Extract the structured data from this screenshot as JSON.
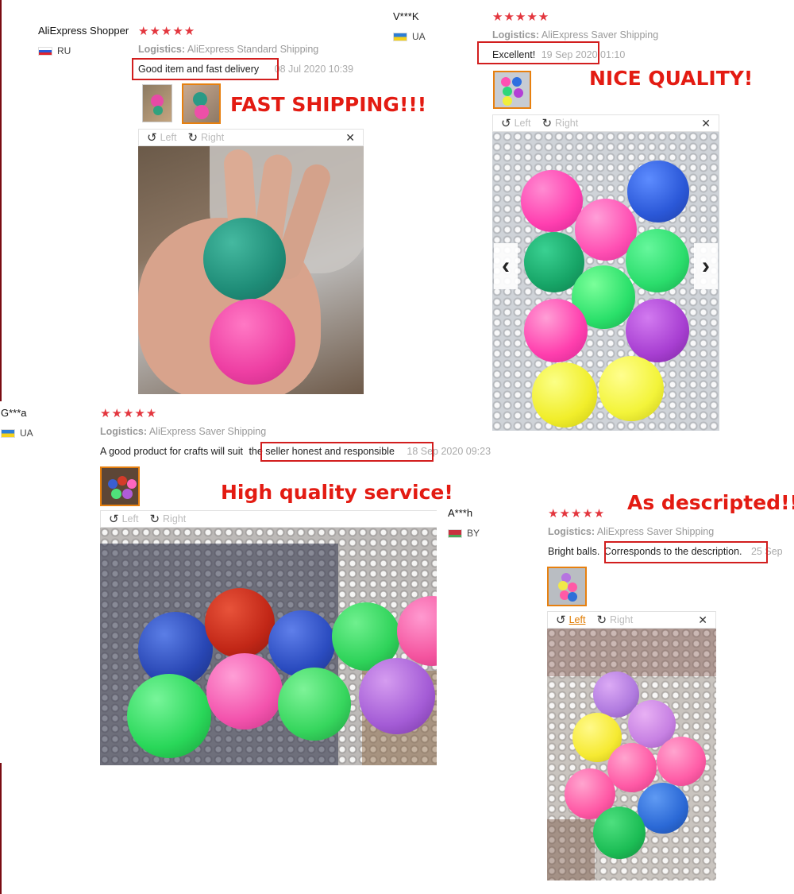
{
  "stars": "★★★★★",
  "reviews": [
    {
      "user": "AliExpress Shopper",
      "country": "RU",
      "logistics_label": "Logistics:",
      "logistics_value": "AliExpress Standard Shipping",
      "text": "Good item and fast delivery",
      "date": "08 Jul 2020 10:39",
      "caption": "FAST SHIPPING!!!",
      "viewer": {
        "left": "Left",
        "right": "Right",
        "close": "✕"
      }
    },
    {
      "user": "V***K",
      "country": "UA",
      "logistics_label": "Logistics:",
      "logistics_value": "AliExpress Saver Shipping",
      "text": "Excellent!",
      "date": "19 Sep 2020 01:10",
      "caption": "NICE QUALITY!",
      "viewer": {
        "left": "Left",
        "right": "Right",
        "close": "✕",
        "prev": "‹",
        "next": "›"
      }
    },
    {
      "user": "G***a",
      "country": "UA",
      "logistics_label": "Logistics:",
      "logistics_value": "AliExpress Saver Shipping",
      "text_plain": "A good product for crafts will suit",
      "text_boxed": "the seller honest and responsible",
      "date": "18 Sep 2020 09:23",
      "caption": "High quality service!",
      "viewer": {
        "left": "Left",
        "right": "Right"
      }
    },
    {
      "user": "A***h",
      "country": "BY",
      "logistics_label": "Logistics:",
      "logistics_value": "AliExpress Saver Shipping",
      "text_plain": "Bright balls.",
      "text_boxed": "Corresponds to the description.",
      "date": "25 Sep",
      "caption": "As descripted!!",
      "viewer": {
        "left": "Left",
        "right": "Right",
        "close": "✕"
      }
    }
  ],
  "colors": {
    "stars": "#e3363e",
    "caption": "#e31b12",
    "highlight_box": "#d21e1e",
    "selected_thumb": "#e7800f"
  }
}
